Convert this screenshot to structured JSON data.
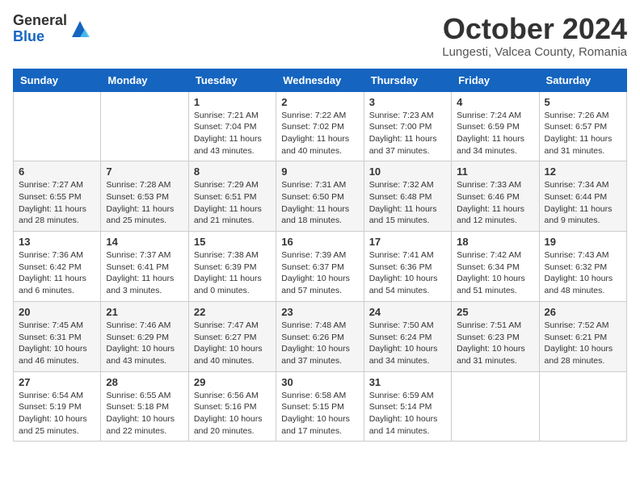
{
  "header": {
    "logo_general": "General",
    "logo_blue": "Blue",
    "month_title": "October 2024",
    "location": "Lungesti, Valcea County, Romania"
  },
  "days_of_week": [
    "Sunday",
    "Monday",
    "Tuesday",
    "Wednesday",
    "Thursday",
    "Friday",
    "Saturday"
  ],
  "weeks": [
    [
      {
        "day": "",
        "info": ""
      },
      {
        "day": "",
        "info": ""
      },
      {
        "day": "1",
        "info": "Sunrise: 7:21 AM\nSunset: 7:04 PM\nDaylight: 11 hours and 43 minutes."
      },
      {
        "day": "2",
        "info": "Sunrise: 7:22 AM\nSunset: 7:02 PM\nDaylight: 11 hours and 40 minutes."
      },
      {
        "day": "3",
        "info": "Sunrise: 7:23 AM\nSunset: 7:00 PM\nDaylight: 11 hours and 37 minutes."
      },
      {
        "day": "4",
        "info": "Sunrise: 7:24 AM\nSunset: 6:59 PM\nDaylight: 11 hours and 34 minutes."
      },
      {
        "day": "5",
        "info": "Sunrise: 7:26 AM\nSunset: 6:57 PM\nDaylight: 11 hours and 31 minutes."
      }
    ],
    [
      {
        "day": "6",
        "info": "Sunrise: 7:27 AM\nSunset: 6:55 PM\nDaylight: 11 hours and 28 minutes."
      },
      {
        "day": "7",
        "info": "Sunrise: 7:28 AM\nSunset: 6:53 PM\nDaylight: 11 hours and 25 minutes."
      },
      {
        "day": "8",
        "info": "Sunrise: 7:29 AM\nSunset: 6:51 PM\nDaylight: 11 hours and 21 minutes."
      },
      {
        "day": "9",
        "info": "Sunrise: 7:31 AM\nSunset: 6:50 PM\nDaylight: 11 hours and 18 minutes."
      },
      {
        "day": "10",
        "info": "Sunrise: 7:32 AM\nSunset: 6:48 PM\nDaylight: 11 hours and 15 minutes."
      },
      {
        "day": "11",
        "info": "Sunrise: 7:33 AM\nSunset: 6:46 PM\nDaylight: 11 hours and 12 minutes."
      },
      {
        "day": "12",
        "info": "Sunrise: 7:34 AM\nSunset: 6:44 PM\nDaylight: 11 hours and 9 minutes."
      }
    ],
    [
      {
        "day": "13",
        "info": "Sunrise: 7:36 AM\nSunset: 6:42 PM\nDaylight: 11 hours and 6 minutes."
      },
      {
        "day": "14",
        "info": "Sunrise: 7:37 AM\nSunset: 6:41 PM\nDaylight: 11 hours and 3 minutes."
      },
      {
        "day": "15",
        "info": "Sunrise: 7:38 AM\nSunset: 6:39 PM\nDaylight: 11 hours and 0 minutes."
      },
      {
        "day": "16",
        "info": "Sunrise: 7:39 AM\nSunset: 6:37 PM\nDaylight: 10 hours and 57 minutes."
      },
      {
        "day": "17",
        "info": "Sunrise: 7:41 AM\nSunset: 6:36 PM\nDaylight: 10 hours and 54 minutes."
      },
      {
        "day": "18",
        "info": "Sunrise: 7:42 AM\nSunset: 6:34 PM\nDaylight: 10 hours and 51 minutes."
      },
      {
        "day": "19",
        "info": "Sunrise: 7:43 AM\nSunset: 6:32 PM\nDaylight: 10 hours and 48 minutes."
      }
    ],
    [
      {
        "day": "20",
        "info": "Sunrise: 7:45 AM\nSunset: 6:31 PM\nDaylight: 10 hours and 46 minutes."
      },
      {
        "day": "21",
        "info": "Sunrise: 7:46 AM\nSunset: 6:29 PM\nDaylight: 10 hours and 43 minutes."
      },
      {
        "day": "22",
        "info": "Sunrise: 7:47 AM\nSunset: 6:27 PM\nDaylight: 10 hours and 40 minutes."
      },
      {
        "day": "23",
        "info": "Sunrise: 7:48 AM\nSunset: 6:26 PM\nDaylight: 10 hours and 37 minutes."
      },
      {
        "day": "24",
        "info": "Sunrise: 7:50 AM\nSunset: 6:24 PM\nDaylight: 10 hours and 34 minutes."
      },
      {
        "day": "25",
        "info": "Sunrise: 7:51 AM\nSunset: 6:23 PM\nDaylight: 10 hours and 31 minutes."
      },
      {
        "day": "26",
        "info": "Sunrise: 7:52 AM\nSunset: 6:21 PM\nDaylight: 10 hours and 28 minutes."
      }
    ],
    [
      {
        "day": "27",
        "info": "Sunrise: 6:54 AM\nSunset: 5:19 PM\nDaylight: 10 hours and 25 minutes."
      },
      {
        "day": "28",
        "info": "Sunrise: 6:55 AM\nSunset: 5:18 PM\nDaylight: 10 hours and 22 minutes."
      },
      {
        "day": "29",
        "info": "Sunrise: 6:56 AM\nSunset: 5:16 PM\nDaylight: 10 hours and 20 minutes."
      },
      {
        "day": "30",
        "info": "Sunrise: 6:58 AM\nSunset: 5:15 PM\nDaylight: 10 hours and 17 minutes."
      },
      {
        "day": "31",
        "info": "Sunrise: 6:59 AM\nSunset: 5:14 PM\nDaylight: 10 hours and 14 minutes."
      },
      {
        "day": "",
        "info": ""
      },
      {
        "day": "",
        "info": ""
      }
    ]
  ]
}
